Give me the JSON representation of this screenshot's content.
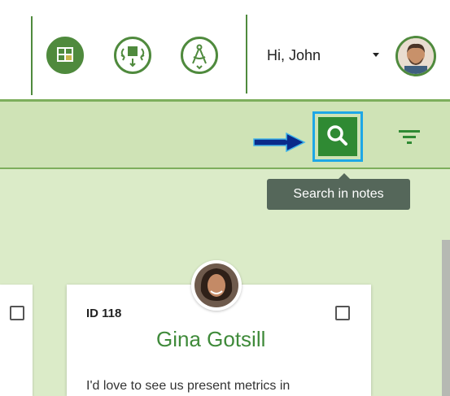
{
  "header": {
    "greeting": "Hi, John",
    "buttons": [
      {
        "icon": "board-layout-icon"
      },
      {
        "icon": "move-arrows-icon"
      },
      {
        "icon": "compass-icon"
      }
    ]
  },
  "toolbar": {
    "search_tooltip": "Search in notes"
  },
  "card": {
    "id_label": "ID 118",
    "name": "Gina Gotsill",
    "text": "I'd love to see us present metrics in"
  },
  "colors": {
    "brand_green": "#4f8a3d",
    "toolbar_bg": "#cfe3b6",
    "board_bg": "#dbebc8",
    "search_button": "#2f8a33",
    "highlight_border": "#1ea7e6",
    "tooltip_bg": "#55675a"
  }
}
